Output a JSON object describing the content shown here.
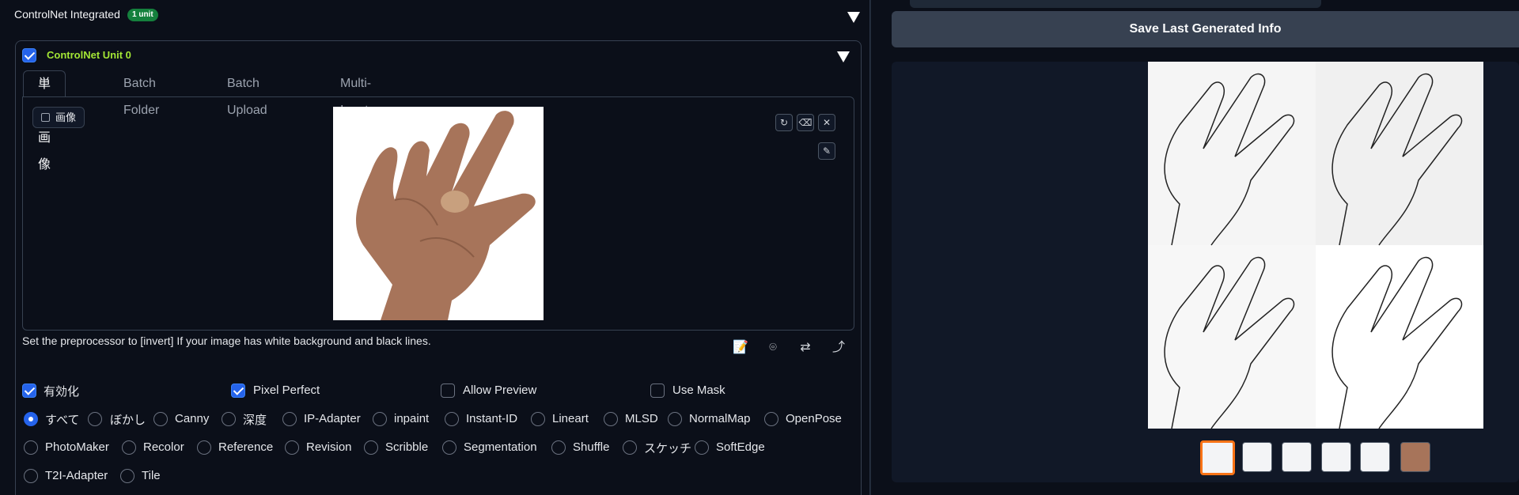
{
  "accordion": {
    "title": "ControlNet Integrated",
    "badge": "1 unit"
  },
  "unit": {
    "title": "ControlNet Unit 0"
  },
  "tabs": [
    "単一画像",
    "Batch Folder",
    "Batch Upload",
    "Multi-Inputs"
  ],
  "image_label": "画像",
  "hint": "Set the preprocessor to [invert] If your image has white background and black lines.",
  "options": {
    "enable": "有効化",
    "pixel_perfect": "Pixel Perfect",
    "allow_preview": "Allow Preview",
    "use_mask": "Use Mask"
  },
  "control_types": [
    "すべて",
    "ぼかし",
    "Canny",
    "深度",
    "IP-Adapter",
    "inpaint",
    "Instant-ID",
    "Lineart",
    "MLSD",
    "NormalMap",
    "OpenPose",
    "PhotoMaker",
    "Recolor",
    "Reference",
    "Revision",
    "Scribble",
    "Segmentation",
    "Shuffle",
    "スケッチ",
    "SoftEdge",
    "T2I-Adapter",
    "Tile"
  ],
  "selected_control_type": "すべて",
  "save_button": "Save Last Generated Info",
  "thumbnails_count": 6,
  "colors": {
    "accent": "#2563eb",
    "badge": "#15803d",
    "unit_title": "#a3e635",
    "selected_thumb": "#f97316"
  },
  "icons": [
    "refresh-icon",
    "eraser-icon",
    "close-icon",
    "brush-icon",
    "notes-icon",
    "camera-icon",
    "swap-icon",
    "send-icon",
    "image-icon"
  ]
}
